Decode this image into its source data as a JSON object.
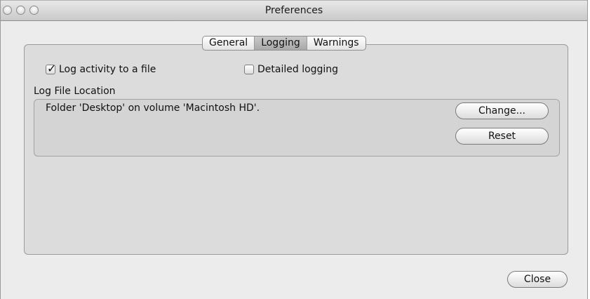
{
  "window": {
    "title": "Preferences"
  },
  "tabs": [
    {
      "label": "General",
      "active": false
    },
    {
      "label": "Logging",
      "active": true
    },
    {
      "label": "Warnings",
      "active": false
    }
  ],
  "logging": {
    "log_to_file": {
      "label": "Log activity to a file",
      "checked": true
    },
    "detailed": {
      "label": "Detailed logging",
      "checked": false
    },
    "location_label": "Log File Location",
    "location_value": "Folder 'Desktop' on volume 'Macintosh HD'.",
    "change_label": "Change...",
    "reset_label": "Reset"
  },
  "footer": {
    "close_label": "Close"
  }
}
